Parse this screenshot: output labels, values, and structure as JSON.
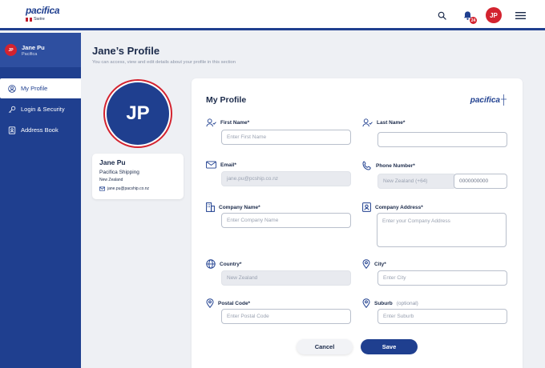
{
  "brand": {
    "name": "pacifica",
    "sub": "Swire",
    "primary_color": "#1f3f8f",
    "accent_color": "#d3232f"
  },
  "topbar": {
    "notification_count": "24",
    "avatar_initials": "JP",
    "icons": [
      "search-icon",
      "bell-icon",
      "menu-icon"
    ]
  },
  "sidebar": {
    "user": {
      "initials": "JP",
      "name": "Jane Pu",
      "company": "Pacifica"
    },
    "items": [
      {
        "label": "My Profile",
        "icon": "user-circle-icon",
        "active": true
      },
      {
        "label": "Login & Security",
        "icon": "key-icon",
        "active": false
      },
      {
        "label": "Address Book",
        "icon": "contact-book-icon",
        "active": false
      }
    ]
  },
  "page": {
    "title": "Jane’s Profile",
    "subtitle": "You can access, view and edit details about your profile in this section"
  },
  "profile_card": {
    "initials": "JP",
    "name": "Jane Pu",
    "company": "Pacifica Shipping",
    "country": "New Zealand",
    "email": "jane.pu@pacship.co.nz"
  },
  "form": {
    "title": "My Profile",
    "logo": "pacifica",
    "first_name": {
      "label": "First Name*",
      "placeholder": "Enter First Name"
    },
    "last_name": {
      "label": "Last Name*",
      "placeholder": ""
    },
    "email": {
      "label": "Email*",
      "value": "jane.pu@pcship.co.nz"
    },
    "phone": {
      "label": "Phone Number*",
      "country": "New Zealand (+64)",
      "value": "0000000000"
    },
    "company_name": {
      "label": "Company Name*",
      "placeholder": "Enter Company Name"
    },
    "company_address": {
      "label": "Company Address*",
      "placeholder": "Enter your Company Address"
    },
    "country": {
      "label": "Country*",
      "value": "New Zealand"
    },
    "city": {
      "label": "City*",
      "placeholder": "Enter City"
    },
    "postal_code": {
      "label": "Postal Code*",
      "placeholder": "Enter Postal Code"
    },
    "suburb": {
      "label": "Suburb",
      "optional": "(optional)",
      "placeholder": "Enter Suburb"
    },
    "cancel_label": "Cancel",
    "save_label": "Save"
  }
}
